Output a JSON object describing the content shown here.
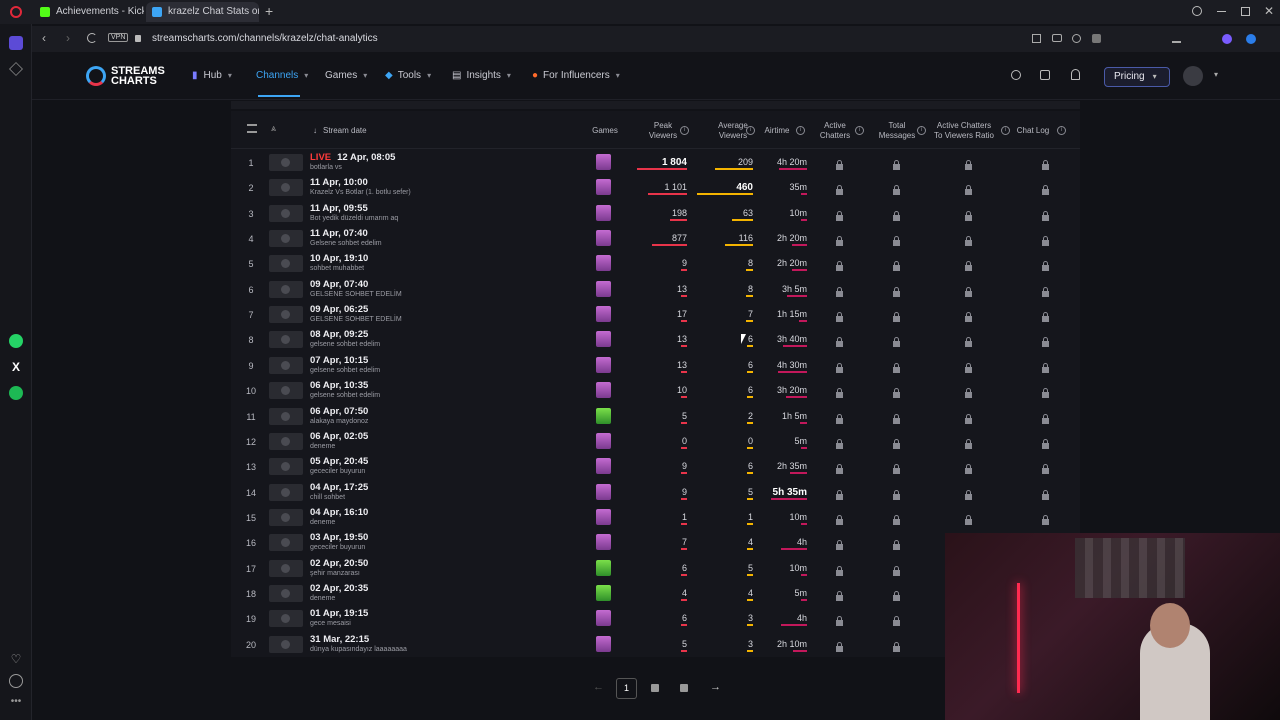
{
  "browser": {
    "tabs": [
      {
        "title": "Achievements - Kick Dash",
        "color": "#53fc18"
      },
      {
        "title": "krazelz Chat Stats on Twi",
        "color": "#3da5f4"
      }
    ],
    "url": "streamscharts.com/channels/krazelz/chat-analytics",
    "vpn": "VPN"
  },
  "site": {
    "logo_line1": "STREAMS",
    "logo_line2": "CHARTS",
    "nav": [
      "Hub",
      "Channels",
      "Games",
      "Tools",
      "Insights",
      "For Influencers"
    ],
    "pricing": "Pricing"
  },
  "table": {
    "headers": {
      "stream_date": "Stream date",
      "games": "Games",
      "peak_viewers": [
        "Peak",
        "Viewers"
      ],
      "average_viewers": [
        "Average",
        "Viewers"
      ],
      "airtime": "Airtime",
      "active_chatters": [
        "Active",
        "Chatters"
      ],
      "total_messages": [
        "Total",
        "Messages"
      ],
      "ratio": [
        "Active Chatters",
        "To Viewers Ratio"
      ],
      "chat_log": "Chat Log"
    },
    "live_label": "LIVE",
    "rows": [
      {
        "rank": "1",
        "date": "12 Apr, 08:05",
        "title": "botlarla vs",
        "live": true,
        "peak": "1 804",
        "avg": "209",
        "airtime": "4h 20m",
        "game": "pink",
        "peak_bold": true
      },
      {
        "rank": "2",
        "date": "11 Apr, 10:00",
        "title": "Krazelz Vs Botlar (1. botlu sefer)",
        "peak": "1 101",
        "avg": "460",
        "airtime": "35m",
        "game": "pink",
        "avg_bold": true
      },
      {
        "rank": "3",
        "date": "11 Apr, 09:55",
        "title": "Bot yedik düzeldi umarım aq",
        "peak": "198",
        "avg": "63",
        "airtime": "10m",
        "game": "pink"
      },
      {
        "rank": "4",
        "date": "11 Apr, 07:40",
        "title": "Gelsene sohbet edelim",
        "peak": "877",
        "avg": "116",
        "airtime": "2h 20m",
        "game": "pink"
      },
      {
        "rank": "5",
        "date": "10 Apr, 19:10",
        "title": "sohbet muhabbet",
        "peak": "9",
        "avg": "8",
        "airtime": "2h 20m",
        "game": "pink"
      },
      {
        "rank": "6",
        "date": "09 Apr, 07:40",
        "title": "GELSENE SOHBET EDELİM",
        "peak": "13",
        "avg": "8",
        "airtime": "3h 5m",
        "game": "pink"
      },
      {
        "rank": "7",
        "date": "09 Apr, 06:25",
        "title": "GELSENE SOHBET EDELİM",
        "peak": "17",
        "avg": "7",
        "airtime": "1h 15m",
        "game": "pink"
      },
      {
        "rank": "8",
        "date": "08 Apr, 09:25",
        "title": "gelsene sohbet edelim",
        "peak": "13",
        "avg": "6",
        "airtime": "3h 40m",
        "game": "pink"
      },
      {
        "rank": "9",
        "date": "07 Apr, 10:15",
        "title": "gelsene sohbet edelim",
        "peak": "13",
        "avg": "6",
        "airtime": "4h 30m",
        "game": "pink"
      },
      {
        "rank": "10",
        "date": "06 Apr, 10:35",
        "title": "gelsene sohbet edelim",
        "peak": "10",
        "avg": "6",
        "airtime": "3h 20m",
        "game": "pink"
      },
      {
        "rank": "11",
        "date": "06 Apr, 07:50",
        "title": "alakaya maydonoz",
        "peak": "5",
        "avg": "2",
        "airtime": "1h 5m",
        "game": "green"
      },
      {
        "rank": "12",
        "date": "06 Apr, 02:05",
        "title": "deneme",
        "peak": "0",
        "avg": "0",
        "airtime": "5m",
        "game": "pink"
      },
      {
        "rank": "13",
        "date": "05 Apr, 20:45",
        "title": "gececiler buyurun",
        "peak": "9",
        "avg": "6",
        "airtime": "2h 35m",
        "game": "pink"
      },
      {
        "rank": "14",
        "date": "04 Apr, 17:25",
        "title": "chill sohbet",
        "peak": "9",
        "avg": "5",
        "airtime": "5h 35m",
        "game": "pink",
        "air_bold": true
      },
      {
        "rank": "15",
        "date": "04 Apr, 16:10",
        "title": "deneme",
        "peak": "1",
        "avg": "1",
        "airtime": "10m",
        "game": "pink"
      },
      {
        "rank": "16",
        "date": "03 Apr, 19:50",
        "title": "gececiler buyurun",
        "peak": "7",
        "avg": "4",
        "airtime": "4h",
        "game": "pink"
      },
      {
        "rank": "17",
        "date": "02 Apr, 20:50",
        "title": "şehir manzarası",
        "peak": "6",
        "avg": "5",
        "airtime": "10m",
        "game": "green"
      },
      {
        "rank": "18",
        "date": "02 Apr, 20:35",
        "title": "deneme",
        "peak": "4",
        "avg": "4",
        "airtime": "5m",
        "game": "green"
      },
      {
        "rank": "19",
        "date": "01 Apr, 19:15",
        "title": "gece mesaisi",
        "peak": "6",
        "avg": "3",
        "airtime": "4h",
        "game": "pink"
      },
      {
        "rank": "20",
        "date": "31 Mar, 22:15",
        "title": "dünya kupasındayız laaaaaaaa",
        "peak": "5",
        "avg": "3",
        "airtime": "2h 10m",
        "game": "pink"
      }
    ]
  },
  "pagination": {
    "current": "1"
  },
  "colors": {
    "accent": "#3da5f4",
    "live": "#ff3b3b",
    "peak_bar": "#e8344a",
    "avg_bar": "#f4b400",
    "air_bar": "#c2185b"
  }
}
